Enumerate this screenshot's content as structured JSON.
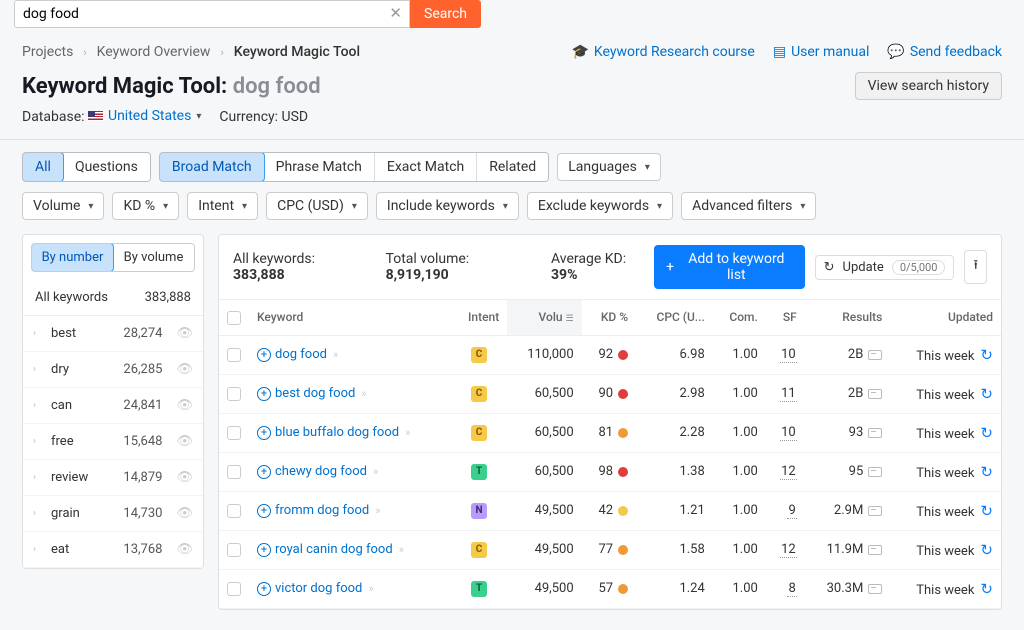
{
  "search": {
    "value": "dog food",
    "button": "Search"
  },
  "breadcrumb": {
    "projects": "Projects",
    "overview": "Keyword Overview",
    "tool": "Keyword Magic Tool"
  },
  "top_links": {
    "course": "Keyword Research course",
    "manual": "User manual",
    "feedback": "Send feedback"
  },
  "title": {
    "tool": "Keyword Magic Tool:",
    "keyword": "dog food"
  },
  "history_btn": "View search history",
  "database": {
    "label": "Database:",
    "value": "United States"
  },
  "currency": {
    "label": "Currency:",
    "value": "USD"
  },
  "match_tabs": {
    "all": "All",
    "questions": "Questions",
    "broad": "Broad Match",
    "phrase": "Phrase Match",
    "exact": "Exact Match",
    "related": "Related"
  },
  "languages": "Languages",
  "filter_pills": {
    "volume": "Volume",
    "kd": "KD %",
    "intent": "Intent",
    "cpc": "CPC (USD)",
    "include": "Include keywords",
    "exclude": "Exclude keywords",
    "advanced": "Advanced filters"
  },
  "sidebar_toggle": {
    "by_number": "By number",
    "by_volume": "By volume"
  },
  "all_keywords": {
    "label": "All keywords",
    "count": "383,888"
  },
  "side_groups": [
    {
      "label": "best",
      "count": "28,274"
    },
    {
      "label": "dry",
      "count": "26,285"
    },
    {
      "label": "can",
      "count": "24,841"
    },
    {
      "label": "free",
      "count": "15,648"
    },
    {
      "label": "review",
      "count": "14,879"
    },
    {
      "label": "grain",
      "count": "14,730"
    },
    {
      "label": "eat",
      "count": "13,768"
    }
  ],
  "summary": {
    "all_kw_label": "All keywords:",
    "all_kw": "383,888",
    "vol_label": "Total volume:",
    "vol": "8,919,190",
    "kd_label": "Average KD:",
    "kd": "39%"
  },
  "buttons": {
    "add": "Add to keyword list",
    "update": "Update",
    "update_count": "0/5,000"
  },
  "cols": {
    "keyword": "Keyword",
    "intent": "Intent",
    "volume": "Volu",
    "kd": "KD %",
    "cpc": "CPC (U...",
    "com": "Com.",
    "sf": "SF",
    "results": "Results",
    "updated": "Updated"
  },
  "rows": [
    {
      "keyword": "dog food",
      "intent": "C",
      "volume": "110,000",
      "kd": "92",
      "kd_color": "kd-red",
      "cpc": "6.98",
      "com": "1.00",
      "sf": "10",
      "results": "2B",
      "updated": "This week"
    },
    {
      "keyword": "best dog food",
      "intent": "C",
      "volume": "60,500",
      "kd": "90",
      "kd_color": "kd-red",
      "cpc": "2.98",
      "com": "1.00",
      "sf": "11",
      "results": "2B",
      "updated": "This week"
    },
    {
      "keyword": "blue buffalo dog food",
      "intent": "C",
      "volume": "60,500",
      "kd": "81",
      "kd_color": "kd-orange",
      "cpc": "2.28",
      "com": "1.00",
      "sf": "10",
      "results": "93",
      "updated": "This week"
    },
    {
      "keyword": "chewy dog food",
      "intent": "T",
      "volume": "60,500",
      "kd": "98",
      "kd_color": "kd-red",
      "cpc": "1.38",
      "com": "1.00",
      "sf": "12",
      "results": "95",
      "updated": "This week"
    },
    {
      "keyword": "fromm dog food",
      "intent": "N",
      "volume": "49,500",
      "kd": "42",
      "kd_color": "kd-yellow",
      "cpc": "1.21",
      "com": "1.00",
      "sf": "9",
      "results": "2.9M",
      "updated": "This week"
    },
    {
      "keyword": "royal canin dog food",
      "intent": "C",
      "volume": "49,500",
      "kd": "77",
      "kd_color": "kd-orange",
      "cpc": "1.58",
      "com": "1.00",
      "sf": "12",
      "results": "11.9M",
      "updated": "This week"
    },
    {
      "keyword": "victor dog food",
      "intent": "T",
      "volume": "49,500",
      "kd": "57",
      "kd_color": "kd-orange",
      "cpc": "1.24",
      "com": "1.00",
      "sf": "8",
      "results": "30.3M",
      "updated": "This week"
    }
  ]
}
